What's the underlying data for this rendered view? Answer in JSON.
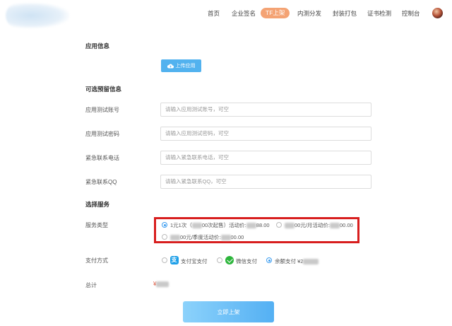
{
  "nav": {
    "items": [
      {
        "label": "首页"
      },
      {
        "label": "企业签名"
      },
      {
        "label": "TF上架"
      },
      {
        "label": "内测分发"
      },
      {
        "label": "封装打包"
      },
      {
        "label": "证书检测"
      },
      {
        "label": "控制台"
      }
    ],
    "active_index": 2
  },
  "app_info": {
    "title": "应用信息",
    "upload_label": "上传应用"
  },
  "optional": {
    "title": "可选预留信息",
    "fields": [
      {
        "label": "应用测试账号",
        "placeholder": "请输入应用测试账号，可空"
      },
      {
        "label": "应用测试密码",
        "placeholder": "请输入应用测试密码，可空"
      },
      {
        "label": "紧急联系电话",
        "placeholder": "请输入紧急联系电话，可空"
      },
      {
        "label": "紧急联系QQ",
        "placeholder": "请输入紧急联系QQ，可空"
      }
    ]
  },
  "service": {
    "title": "选择服务",
    "type_label": "服务类型",
    "options": [
      {
        "prefix": "1元1次（",
        "middle": "00次起售）活动价:",
        "price": "88.00",
        "checked": true
      },
      {
        "prefix": "",
        "middle": "00元/月活动价:",
        "price": "00.00",
        "checked": false
      },
      {
        "prefix": "",
        "middle": "00元/季度活动价:",
        "price": "00.00",
        "checked": false
      }
    ]
  },
  "payment": {
    "label": "支付方式",
    "methods": [
      {
        "label": "支付宝支付",
        "icon": "alipay-icon",
        "checked": false
      },
      {
        "label": "微信支付",
        "icon": "wechat-icon",
        "checked": false
      },
      {
        "label": "余额支付 ¥2",
        "icon": "",
        "checked": true
      }
    ]
  },
  "total": {
    "label": "总计",
    "value": "¥"
  },
  "submit_label": "立即上架",
  "colors": {
    "accent_blue": "#52b2ef",
    "nav_active": "#f4a374",
    "highlight_border": "#d81e1e",
    "total_red": "#e04a2e"
  }
}
